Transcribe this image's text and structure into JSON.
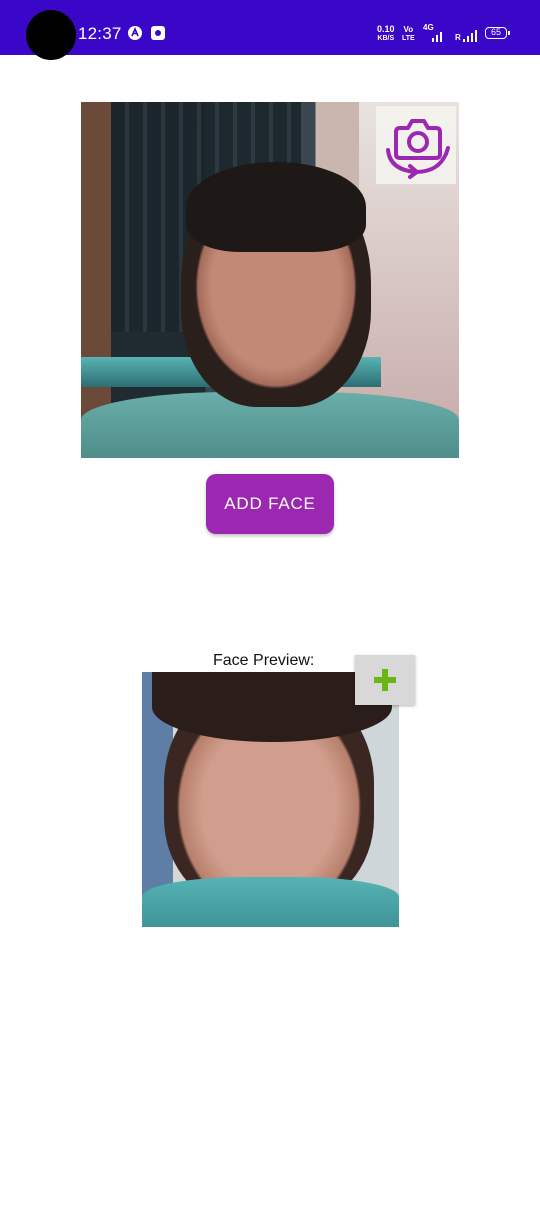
{
  "status_bar": {
    "time": "12:37",
    "net_speed_value": "0.10",
    "net_speed_unit": "KB/S",
    "volte_top": "Vo",
    "volte_bottom": "LTE",
    "network_type": "4G",
    "roaming": "R",
    "battery_level": "65",
    "icons": [
      "auto-sync-icon",
      "notification-app-icon",
      "signal-icon",
      "battery-icon"
    ]
  },
  "camera": {
    "switch_camera_icon": "switch-camera-icon",
    "accent_color": "#9c27b0"
  },
  "actions": {
    "add_face_label": "ADD FACE"
  },
  "preview": {
    "label": "Face Preview:",
    "add_icon": "plus-icon",
    "add_icon_color": "#6ab612"
  },
  "colors": {
    "status_bar_bg": "#3a06c8",
    "button_bg": "#9c27b0"
  }
}
